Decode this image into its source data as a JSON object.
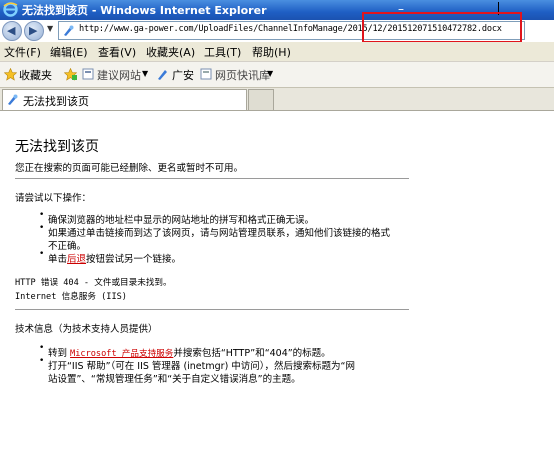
{
  "window": {
    "title": "无法找到该页 - Windows Internet Explorer"
  },
  "address_bar": {
    "url": "http://www.ga-power.com/UploadFiles/ChannelInfoManage/2015/12/20151207151047278​2.docx"
  },
  "menu": [
    "文件(F)",
    "编辑(E)",
    "查看(V)",
    "收藏夹(A)",
    "工具(T)",
    "帮助(H)"
  ],
  "favorites_bar": {
    "favorites": "收藏夹",
    "suggested_sites": "建议网站",
    "guangan": "广安",
    "web_slice_gallery": "网页快讯库"
  },
  "tab": {
    "label": "无法找到该页"
  },
  "page": {
    "heading": "无法找到该页",
    "intro": "您正在搜索的页面可能已经删除、更名或暂时不可用。",
    "try_heading": "请尝试以下操作：",
    "try_items": [
      "确保浏览器的地址栏中显示的网站地址的拼写和格式正确无误。",
      "如果通过单击链接而到达了该网页，请与网站管理员联系，通知他们该链接的格式",
      "不正确。",
      "单击",
      "后退",
      "按钮尝试另一个链接。"
    ],
    "http_error": "HTTP 错误 404 - 文件或目录未找到。",
    "iis": "Internet 信息服务 (IIS)",
    "tech_heading": "技术信息（为技术支持人员提供）",
    "tech_items": [
      "转到",
      "Microsoft 产品支持服务",
      "并搜索包括“HTTP”和“404”的标题。",
      "打开“IIS 帮助”（可在 IIS 管理器 (inetmgr) 中访问），然后搜索标题为“网",
      "站设置”、“常规管理任务”和“关于自定义错误消息”的主题。"
    ]
  },
  "colors": {
    "titlebar": "#1f5fc4",
    "highlight_box": "#e0141c",
    "link": "#cc0000"
  }
}
